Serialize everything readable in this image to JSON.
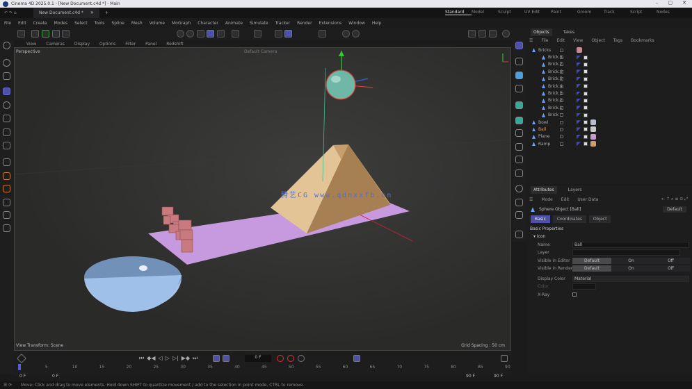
{
  "window": {
    "title": "Cinema 4D 2025.0.1 - [New Document.c4d *] - Main"
  },
  "doc_tab": {
    "label": "New Document.c4d *"
  },
  "layouts": [
    "Standard",
    "Model",
    "Sculpt",
    "UV Edit",
    "Paint",
    "Groom",
    "Track",
    "Script",
    "Nodes"
  ],
  "active_layout": "Standard",
  "menu": [
    "File",
    "Edit",
    "Create",
    "Modes",
    "Select",
    "Tools",
    "Spline",
    "Mesh",
    "Volume",
    "MoGraph",
    "Character",
    "Animate",
    "Simulate",
    "Tracker",
    "Render",
    "Extensions",
    "Window",
    "Help"
  ],
  "viewport": {
    "menu": [
      "View",
      "Cameras",
      "Display",
      "Options",
      "Filter",
      "Panel",
      "Redshift"
    ],
    "name": "Perspective",
    "camera": "Default Camera",
    "footer_left": "View Transform: Scene",
    "grid": "Grid Spacing : 50 cm",
    "watermark": "腾艺CG  www.qdnxxfb.cn"
  },
  "objects_panel": {
    "tabs": [
      "Objects",
      "Takes"
    ],
    "menu": [
      "File",
      "Edit",
      "View",
      "Object",
      "Tags",
      "Bookmarks"
    ],
    "items": [
      {
        "name": "Bricks",
        "level": 0,
        "material": "#c98a96"
      },
      {
        "name": "Brick.8",
        "level": 1
      },
      {
        "name": "Brick.7",
        "level": 1
      },
      {
        "name": "Brick.6",
        "level": 1
      },
      {
        "name": "Brick.5",
        "level": 1
      },
      {
        "name": "Brick.4",
        "level": 1
      },
      {
        "name": "Brick.3",
        "level": 1
      },
      {
        "name": "Brick.2",
        "level": 1
      },
      {
        "name": "Brick.1",
        "level": 1
      },
      {
        "name": "Brick",
        "level": 1
      },
      {
        "name": "Bowl",
        "level": 0,
        "material": "#b8c0d0"
      },
      {
        "name": "Ball",
        "level": 0,
        "selected": true,
        "material": "#c8c8c8"
      },
      {
        "name": "Plane",
        "level": 0,
        "material": "#c89ad0"
      },
      {
        "name": "Ramp",
        "level": 0,
        "material": "#c9a070"
      }
    ]
  },
  "attributes": {
    "tabs": [
      "Attributes",
      "Layers"
    ],
    "menu": [
      "Mode",
      "Edit",
      "User Data"
    ],
    "object_title": "Sphere Object [Ball]",
    "preset": "Default",
    "subtabs": [
      "Basic",
      "Coordinates",
      "Object"
    ],
    "active_subtab": "Basic",
    "section": "Basic Properties",
    "group": "Icon",
    "rows": [
      {
        "label": "Name",
        "value": "Ball"
      },
      {
        "label": "Layer",
        "value": ""
      },
      {
        "label": "Visible in Editor",
        "options": [
          "Default",
          "On",
          "Off"
        ],
        "selected": "Default"
      },
      {
        "label": "Visible in Renderer",
        "options": [
          "Default",
          "On",
          "Off"
        ],
        "selected": "Default"
      },
      {
        "label": "Display Color",
        "value": "Material"
      },
      {
        "label": "Color",
        "value": ""
      },
      {
        "label": "X-Ray",
        "checked": false
      }
    ]
  },
  "timeline": {
    "current_frame": "0 F",
    "start": "0 F",
    "end_preview": "90 F",
    "end": "90 F",
    "ticks": [
      "0",
      "5",
      "10",
      "15",
      "20",
      "25",
      "30",
      "35",
      "40",
      "45",
      "50",
      "55",
      "60",
      "65",
      "70",
      "75",
      "80",
      "85",
      "90"
    ]
  },
  "status": "Move: Click and drag to move elements. Hold down SHIFT to quantize movement / add to the selection in point mode, CTRL to remove.",
  "colors": {
    "accent": "#4f50a8",
    "selected_object": "#e8964a",
    "plane": "#c79ae0",
    "ramp": "#d8b888",
    "sphere": "#6fb8a8",
    "bowl": "#9fc0e8",
    "bricks": "#c8787c"
  }
}
